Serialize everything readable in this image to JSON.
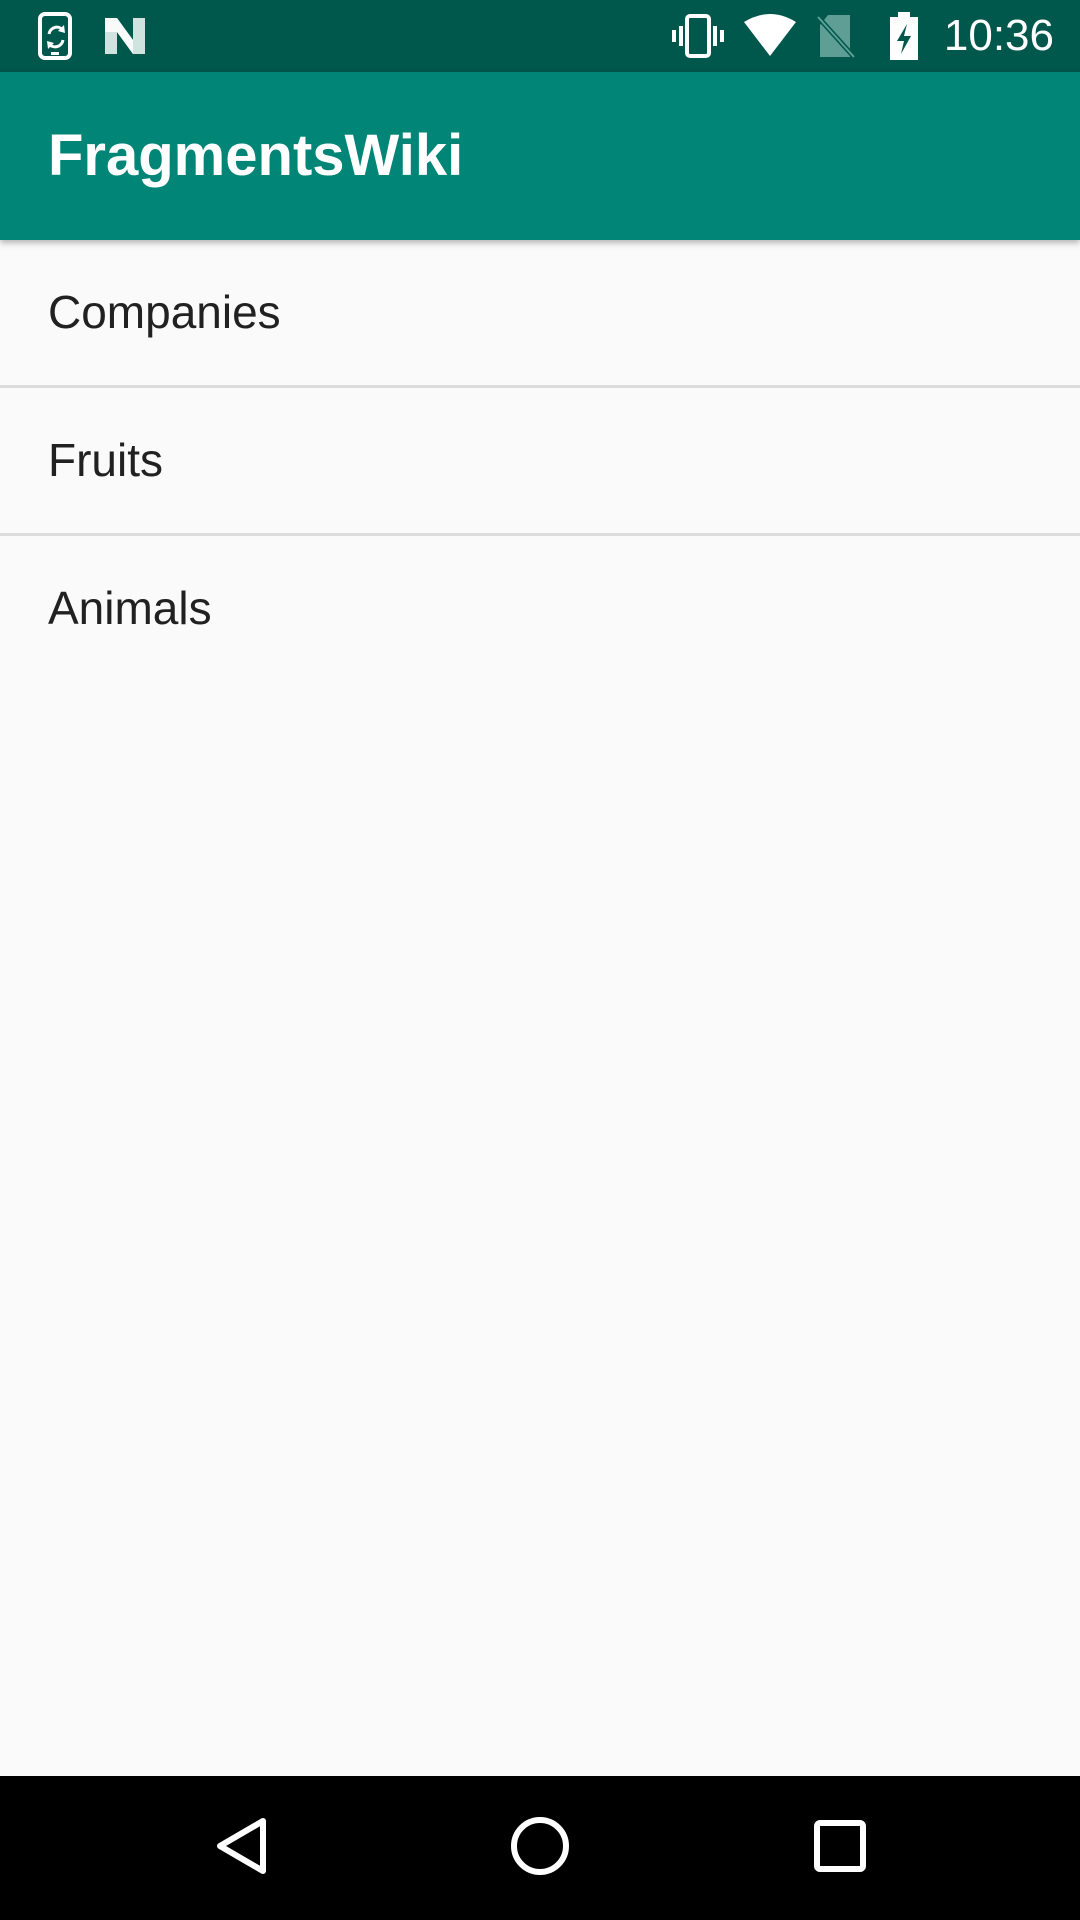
{
  "status_bar": {
    "time": "10:36",
    "background_color": "#00574b",
    "icons": [
      "phone-sync-icon",
      "n-logo-icon",
      "vibrate-icon",
      "wifi-icon",
      "no-sim-icon",
      "battery-charging-icon"
    ]
  },
  "app_bar": {
    "title": "FragmentsWiki",
    "background_color": "#008577"
  },
  "list": {
    "items": [
      {
        "label": "Companies"
      },
      {
        "label": "Fruits"
      },
      {
        "label": "Animals"
      }
    ]
  },
  "nav_bar": {
    "buttons": [
      "back-icon",
      "home-icon",
      "recents-icon"
    ]
  }
}
